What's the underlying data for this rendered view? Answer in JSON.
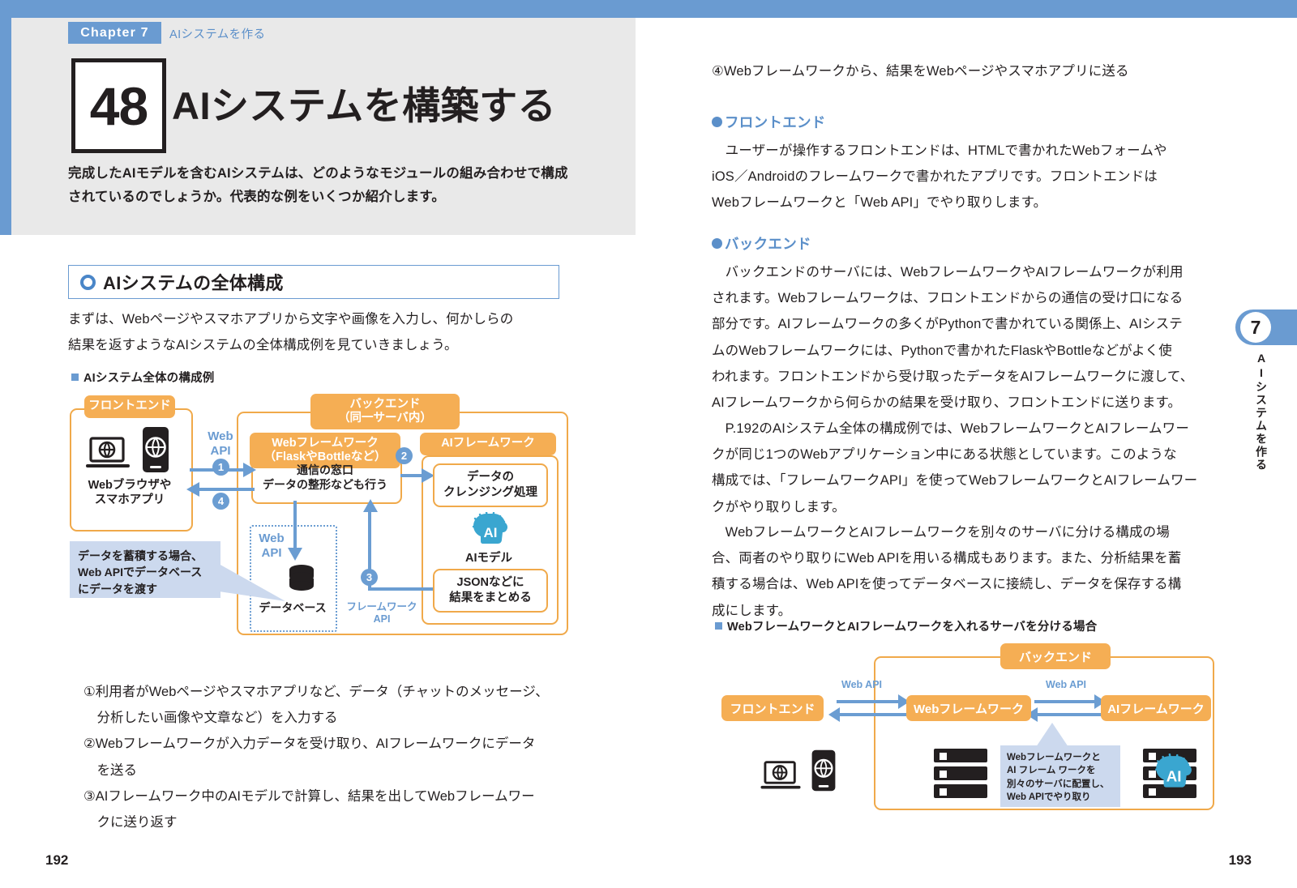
{
  "header": {
    "chapter_tag": "Chapter 7",
    "chapter_subtitle": "AIシステムを作る",
    "section_number": "48",
    "section_title": "AIシステムを構築する",
    "lead_line1": "完成したAIモデルを含むAIシステムは、どのようなモジュールの組み合わせで構成",
    "lead_line2": "されているのでしょうか。代表的な例をいくつか紹介します。"
  },
  "left_page": {
    "heading": "AIシステムの全体構成",
    "paragraph_line1": "まずは、Webページやスマホアプリから文字や画像を入力し、何かしらの",
    "paragraph_line2": "結果を返すようなAIシステムの全体構成例を見ていきましょう。",
    "figure_caption": "AIシステム全体の構成例",
    "list": [
      "①利用者がWebページやスマホアプリなど、データ（チャットのメッセージ、",
      "　分析したい画像や文章など）を入力する",
      "②Webフレームワークが入力データを受け取り、AIフレームワークにデータ",
      "　を送る",
      "③AIフレームワーク中のAIモデルで計算し、結果を出してWebフレームワー",
      "　クに送り返す"
    ],
    "page_number": "192"
  },
  "diagram1": {
    "frontend_tab": "フロントエンド",
    "frontend_label_line1": "Webブラウザや",
    "frontend_label_line2": "スマホアプリ",
    "backend_tab_line1": "バックエンド",
    "backend_tab_line2": "（同一サーバ内）",
    "webfw_tab_line1": "Webフレームワーク",
    "webfw_tab_line2": "（FlaskやBottleなど）",
    "webfw_body_line1": "通信の窓口",
    "webfw_body_line2": "データの整形なども行う",
    "aifw_tab": "AIフレームワーク",
    "cleansing_line1": "データの",
    "cleansing_line2": "クレンジング処理",
    "ai_model_label": "AIモデル",
    "ai_badge": "AI",
    "json_line1": "JSONなどに",
    "json_line2": "結果をまとめる",
    "database_label": "データベース",
    "webapi_1_line1": "Web",
    "webapi_1_line2": "API",
    "webapi_2_line1": "Web",
    "webapi_2_line2": "API",
    "framework_api_line1": "フレームワーク",
    "framework_api_line2": "API",
    "step1": "1",
    "step2": "2",
    "step3": "3",
    "step4": "4",
    "callout_line1": "データを蓄積する場合、",
    "callout_line2": "Web APIでデータベース",
    "callout_line3": "にデータを渡す"
  },
  "right_page": {
    "item4": "④Webフレームワークから、結果をWebページやスマホアプリに送る",
    "frontend_heading": "フロントエンド",
    "frontend_p": [
      "　ユーザーが操作するフロントエンドは、HTMLで書かれたWebフォームや",
      "iOS／Androidのフレームワークで書かれたアプリです。フロントエンドは",
      "Webフレームワークと「Web API」でやり取りします。"
    ],
    "backend_heading": "バックエンド",
    "backend_p1": [
      "　バックエンドのサーバには、WebフレームワークやAIフレームワークが利用",
      "されます。Webフレームワークは、フロントエンドからの通信の受け口になる",
      "部分です。AIフレームワークの多くがPythonで書かれている関係上、AIシステ",
      "ムのWebフレームワークには、Pythonで書かれたFlaskやBottleなどがよく使",
      "われます。フロントエンドから受け取ったデータをAIフレームワークに渡して、",
      "AIフレームワークから何らかの結果を受け取り、フロントエンドに送ります。"
    ],
    "backend_p2": [
      "　P.192のAIシステム全体の構成例では、WebフレームワークとAIフレームワー",
      "クが同じ1つのWebアプリケーション中にある状態としています。このような",
      "構成では、「フレームワークAPI」を使ってWebフレームワークとAIフレームワー",
      "クがやり取りします。"
    ],
    "backend_p3": [
      "　WebフレームワークとAIフレームワークを別々のサーバに分ける構成の場",
      "合、両者のやり取りにWeb APIを用いる構成もあります。また、分析結果を蓄",
      "積する場合は、Web APIを使ってデータベースに接続し、データを保存する構",
      "成にします。"
    ],
    "figure_caption": "WebフレームワークとAIフレームワークを入れるサーバを分ける場合",
    "page_number": "193"
  },
  "diagram2": {
    "backend_tab": "バックエンド",
    "frontend_tab": "フロントエンド",
    "webfw_tab": "Webフレームワーク",
    "aifw_tab": "AIフレームワーク",
    "webapi_left": "Web API",
    "webapi_right": "Web API",
    "ai_badge": "AI",
    "callout_line1": "Webフレームワークと",
    "callout_line2": "AI フレーム ワークを",
    "callout_line3": "別々のサーバに配置し、",
    "callout_line4": "Web APIでやり取り"
  },
  "side_tab": {
    "number": "7",
    "label": "AIシステムを作る"
  }
}
